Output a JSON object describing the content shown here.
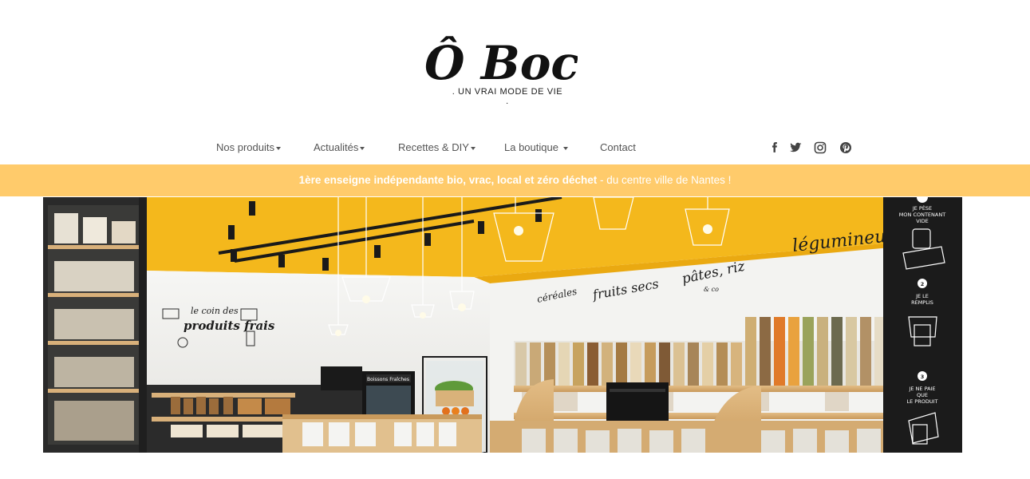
{
  "brand": {
    "logo_text": "Ô Bocal",
    "tagline": ". UN VRAI MODE DE VIE ."
  },
  "nav": {
    "items": [
      {
        "label": "Nos produits",
        "dropdown": true
      },
      {
        "label": "Actualités",
        "dropdown": true
      },
      {
        "label": "Recettes & DIY",
        "dropdown": true
      },
      {
        "label": "La boutique",
        "dropdown": true
      },
      {
        "label": "Contact",
        "dropdown": false
      }
    ]
  },
  "social": {
    "icons": [
      "facebook-icon",
      "twitter-icon",
      "instagram-icon",
      "pinterest-icon"
    ],
    "color": "#444444"
  },
  "banner": {
    "strong_text": "1ère enseigne indépendante bio, vrac, local et zéro déchet",
    "rest_text": " - du centre ville de Nantes !",
    "background": "#ffcb6b"
  },
  "hero": {
    "labels": {
      "produits_frais_line1": "le coin des",
      "produits_frais_line2": "produits frais",
      "cereales": "céréales",
      "fruits_secs": "fruits secs",
      "pates_riz": "pâtes, riz",
      "pates_riz_sub": "& co",
      "legumineuses": "légumineuse",
      "boissons": "Boissons Fraîches"
    },
    "chalkboard": {
      "step1_num": "1",
      "step1": [
        "JE PÈSE",
        "MON CONTENANT",
        "VIDE"
      ],
      "step2_num": "2",
      "step2": [
        "JE LE",
        "REMPLIS"
      ],
      "step3_num": "3",
      "step3": [
        "JE NE PAIE",
        "QUE",
        "LE PRODUIT"
      ]
    },
    "colors": {
      "ceiling": "#f4b81c",
      "wall": "#f2f2f0",
      "wood": "#d9b27a",
      "black": "#1b1b1b"
    }
  }
}
